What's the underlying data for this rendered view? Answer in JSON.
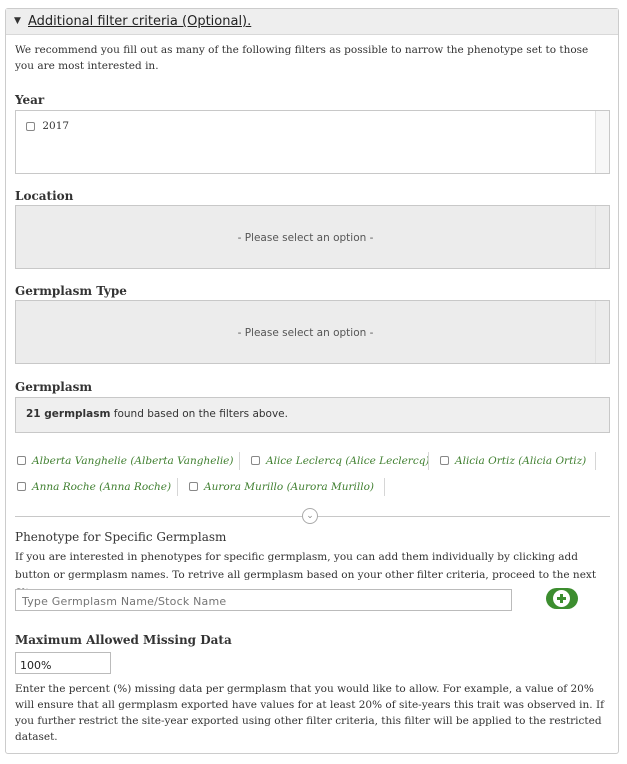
{
  "legend": {
    "title": "Additional filter criteria (Optional)."
  },
  "intro": "We recommend you fill out as many of the following filters as possible to narrow the phenotype set to those you are most interested in.",
  "year": {
    "label": "Year",
    "options": [
      "2017"
    ]
  },
  "location": {
    "label": "Location",
    "placeholder": "- Please select an option -"
  },
  "germplasm_type": {
    "label": "Germplasm Type",
    "placeholder": "- Please select an option -"
  },
  "germplasm": {
    "label": "Germplasm",
    "count": "21 germplasm",
    "found_text": "found based on the filters above.",
    "items": [
      "Alberta Vanghelie (Alberta Vanghelie)",
      "Alice Leclercq (Alice Leclercq)",
      "Alicia Ortiz (Alicia Ortiz)",
      "Anna Roche (Anna Roche)",
      "Aurora Murillo (Aurora Murillo)"
    ]
  },
  "specific": {
    "title": "Phenotype for Specific Germplasm",
    "description": "If you are interested in phenotypes for specific germplasm, you can add them individually by clicking add button or germplasm names. To retrive all germplasm based on your other filter criteria, proceed to the next filter.",
    "input_placeholder": "Type Germplasm Name/Stock Name"
  },
  "missing": {
    "label": "Maximum Allowed Missing Data",
    "value": "100%",
    "description": "Enter the percent (%) missing data per germplasm that you would like to allow. For example, a value of 20% will ensure that all germplasm exported have values for at least 20% of site-years this trait was observed in. If you further restrict the site-year exported using other filter criteria, this filter will be applied to the restricted dataset."
  },
  "colors": {
    "accent_green": "#3c8d2f",
    "germplasm_link": "#3f7f2f"
  }
}
